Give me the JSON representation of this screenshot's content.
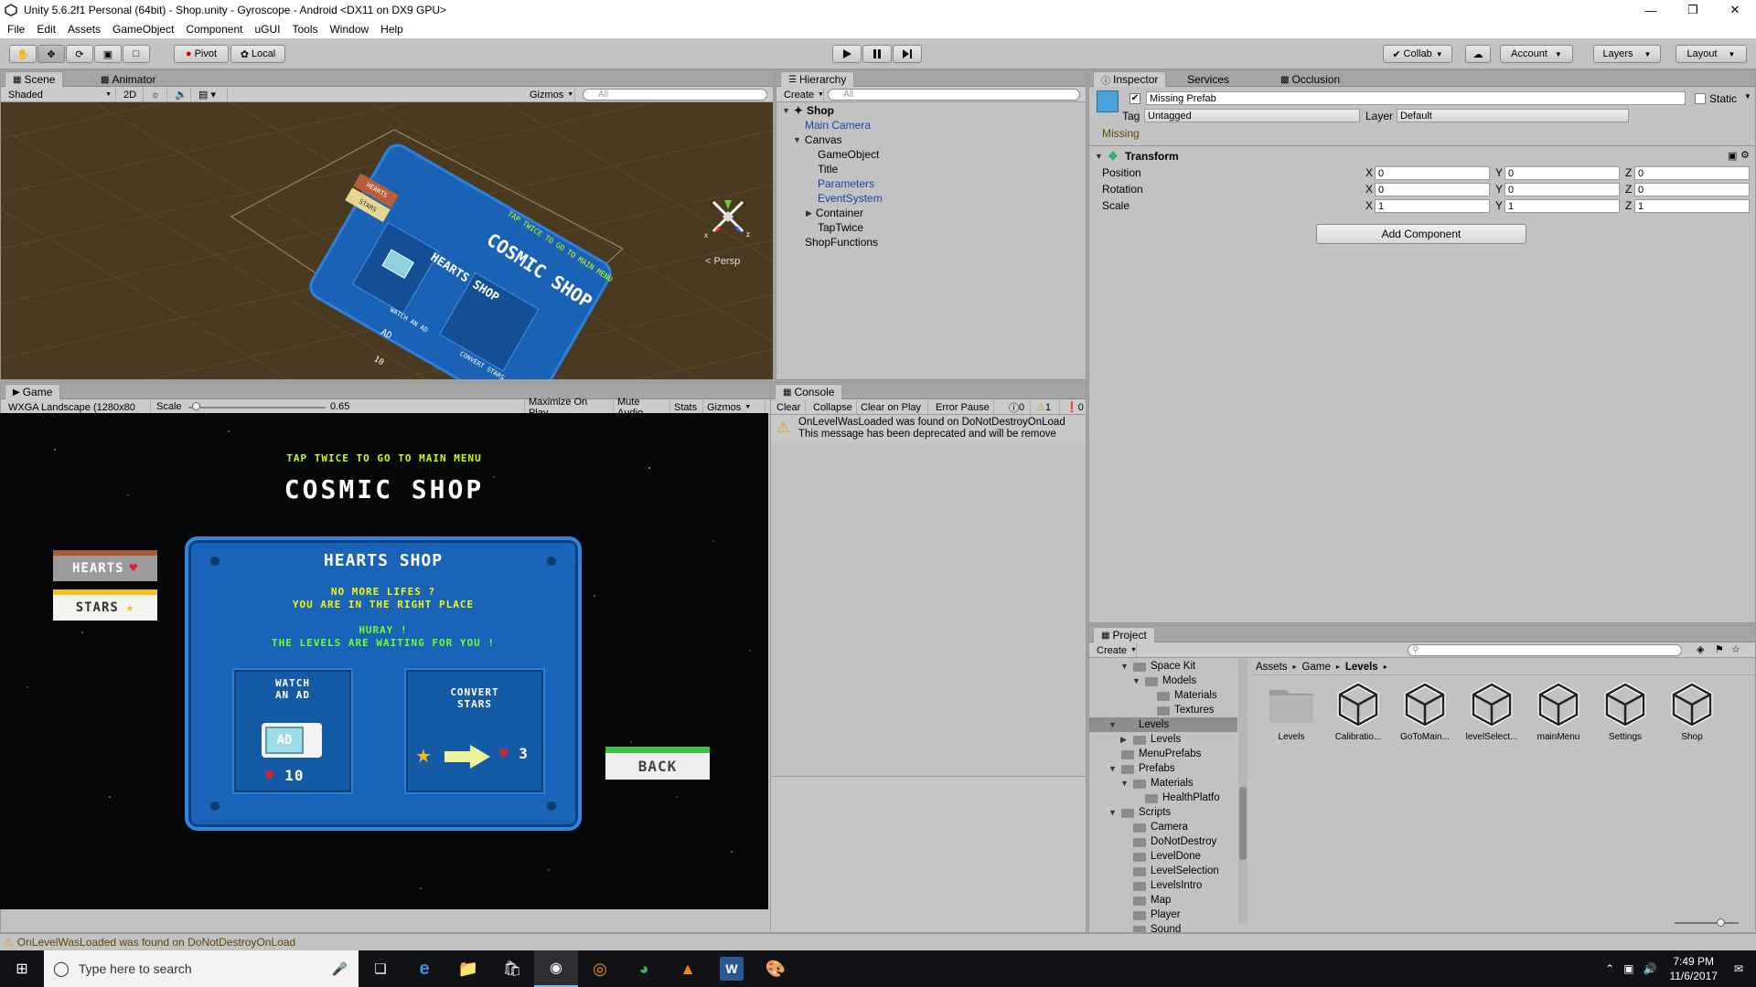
{
  "window": {
    "title": "Unity 5.6.2f1 Personal (64bit) - Shop.unity - Gyroscope - Android <DX11 on DX9 GPU>"
  },
  "menu": [
    "File",
    "Edit",
    "Assets",
    "GameObject",
    "Component",
    "uGUI",
    "Tools",
    "Window",
    "Help"
  ],
  "toolbar": {
    "pivot": "Pivot",
    "local": "Local",
    "collab": "Collab",
    "account": "Account",
    "layers": "Layers",
    "layout": "Layout"
  },
  "scene": {
    "tabs": [
      "Scene",
      "Animator"
    ],
    "shading": "Shaded",
    "mode2d": "2D",
    "gizmos": "Gizmos",
    "search_placeholder": "All",
    "persp": "< Persp",
    "overlay": {
      "tap": "TAP TWICE TO GO TO MAIN MENU",
      "title": "COSMIC SHOP",
      "hearts_shop": "HEARTS SHOP",
      "hearts_tag": "HEARTS",
      "stars_tag": "STARS",
      "watch": "WATCH AN AD",
      "ad": "AD",
      "ten": "10",
      "convert": "CONVERT STARS"
    }
  },
  "hierarchy": {
    "tab": "Hierarchy",
    "create": "Create",
    "search_placeholder": "All",
    "root": "Shop",
    "items": [
      "Main Camera",
      "Canvas",
      "GameObject",
      "Title",
      "Parameters",
      "EventSystem",
      "Container",
      "TapTwice",
      "ShopFunctions"
    ]
  },
  "inspector": {
    "tabs": [
      "Inspector",
      "Services",
      "Occlusion"
    ],
    "object_name": "Missing Prefab",
    "static": "Static",
    "tag_label": "Tag",
    "tag": "Untagged",
    "layer_label": "Layer",
    "layer": "Default",
    "missing": "Missing",
    "component": "Transform",
    "rows": [
      {
        "label": "Position",
        "x": "0",
        "y": "0",
        "z": "0"
      },
      {
        "label": "Rotation",
        "x": "0",
        "y": "0",
        "z": "0"
      },
      {
        "label": "Scale",
        "x": "1",
        "y": "1",
        "z": "1"
      }
    ],
    "axes": [
      "X",
      "Y",
      "Z"
    ],
    "add_component": "Add Component"
  },
  "game": {
    "tab": "Game",
    "resolution": "WXGA Landscape (1280x80",
    "scale_label": "Scale",
    "scale_value": "0.65",
    "scale_level": 0.05,
    "buttons": [
      "Maximize On Play",
      "Mute Audio",
      "Stats",
      "Gizmos"
    ],
    "tap_text": "TAP TWICE TO GO TO MAIN MENU",
    "title": "COSMIC SHOP",
    "hearts_btn": "HEARTS",
    "stars_btn": "STARS",
    "shop_title": "HEARTS SHOP",
    "line1": "NO MORE LIFES ?",
    "line2": "YOU ARE IN THE RIGHT PLACE",
    "line3": "HURAY !",
    "line4": "THE LEVELS ARE WAITING FOR YOU !",
    "watch1": "WATCH",
    "watch2": "AN AD",
    "ad": "AD",
    "ad_reward": "10",
    "convert1": "CONVERT",
    "convert2": "STARS",
    "convert_reward": "3",
    "back": "BACK"
  },
  "console": {
    "tab": "Console",
    "buttons": [
      "Clear",
      "Collapse",
      "Clear on Play",
      "Error Pause"
    ],
    "count_info": "0",
    "count_warn": "1",
    "count_err": "0",
    "message1": "OnLevelWasLoaded was found on DoNotDestroyOnLoad",
    "message2": "This message has been deprecated and will be remove"
  },
  "project": {
    "tab": "Project",
    "create": "Create",
    "breadcrumb": [
      "Assets",
      "Game",
      "Levels"
    ],
    "tree": [
      {
        "label": "Space Kit",
        "depth": 2,
        "open": true
      },
      {
        "label": "Models",
        "depth": 3,
        "open": true
      },
      {
        "label": "Materials",
        "depth": 4
      },
      {
        "label": "Textures",
        "depth": 4
      },
      {
        "label": "Levels",
        "depth": 1,
        "open": true,
        "selected": true
      },
      {
        "label": "Levels",
        "depth": 2,
        "closed": true
      },
      {
        "label": "MenuPrefabs",
        "depth": 1
      },
      {
        "label": "Prefabs",
        "depth": 1,
        "open": true
      },
      {
        "label": "Materials",
        "depth": 2,
        "open": true
      },
      {
        "label": "HealthPlatfo",
        "depth": 3
      },
      {
        "label": "Scripts",
        "depth": 1,
        "open": true
      },
      {
        "label": "Camera",
        "depth": 2
      },
      {
        "label": "DoNotDestroy",
        "depth": 2
      },
      {
        "label": "LevelDone",
        "depth": 2
      },
      {
        "label": "LevelSelection",
        "depth": 2
      },
      {
        "label": "LevelsIntro",
        "depth": 2
      },
      {
        "label": "Map",
        "depth": 2
      },
      {
        "label": "Player",
        "depth": 2
      },
      {
        "label": "Sound",
        "depth": 2
      }
    ],
    "assets": [
      "Levels",
      "Calibratio...",
      "GoToMain...",
      "levelSelect...",
      "mainMenu",
      "Settings",
      "Shop"
    ]
  },
  "status_message": "OnLevelWasLoaded was found on DoNotDestroyOnLoad",
  "taskbar": {
    "search": "Type here to search",
    "time": "7:49 PM",
    "date": "11/6/2017"
  }
}
